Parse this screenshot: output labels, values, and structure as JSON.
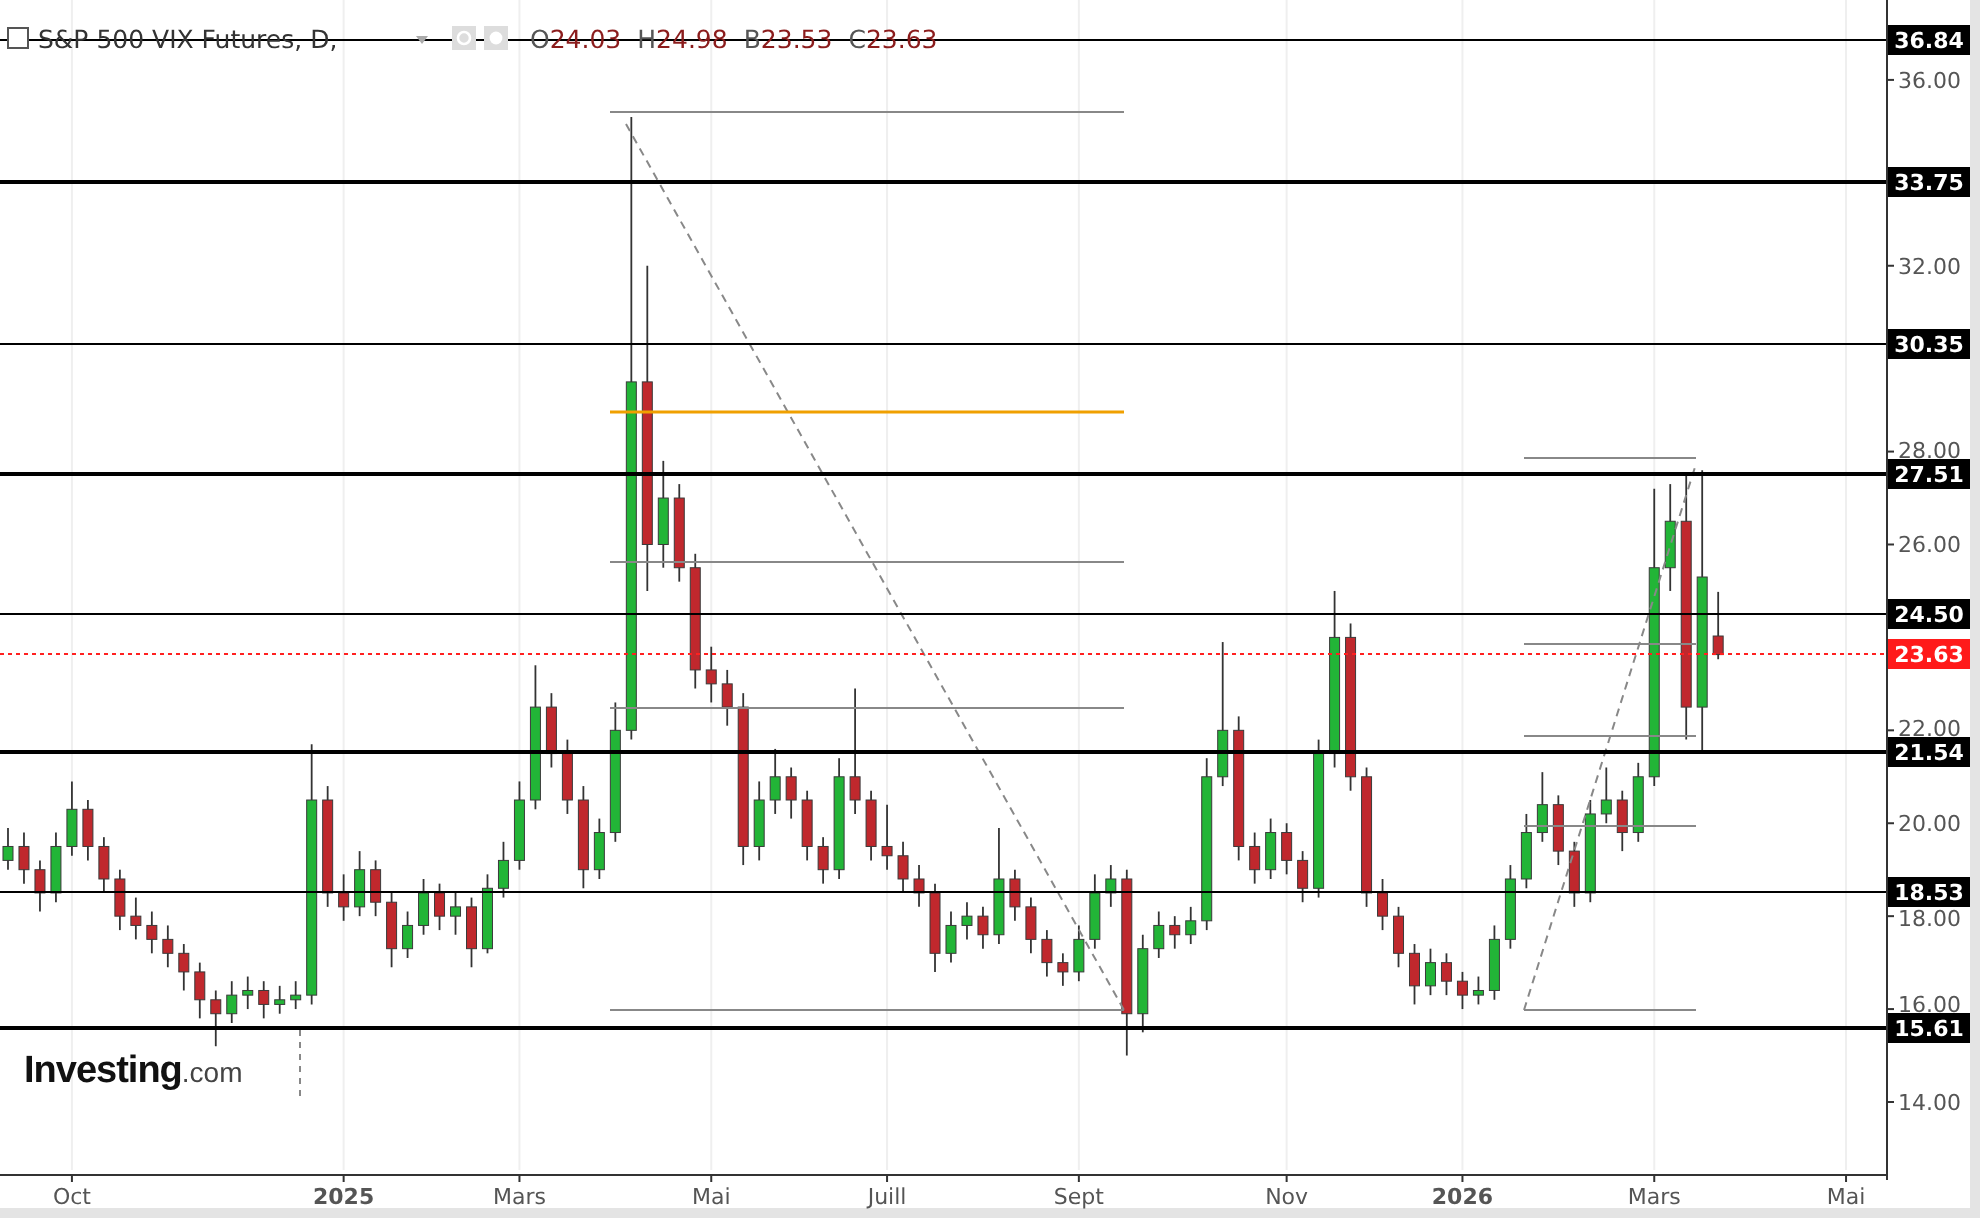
{
  "header": {
    "title": "S&P 500 VIX Futures, D,",
    "quote": [
      {
        "key": "O",
        "value": "24.03"
      },
      {
        "key": "H",
        "value": "24.98"
      },
      {
        "key": "B",
        "value": "23.53"
      },
      {
        "key": "C",
        "value": "23.63"
      }
    ]
  },
  "chart": {
    "chart_data": {
      "type": "candlestick",
      "categories": [
        null,
        null,
        null,
        null,
        "Oct",
        null,
        null,
        null,
        null,
        null,
        null,
        null,
        null,
        null,
        null,
        null,
        null,
        null,
        null,
        null,
        null,
        "2025",
        null,
        null,
        null,
        null,
        null,
        null,
        null,
        null,
        null,
        null,
        "Mars",
        null,
        null,
        null,
        null,
        null,
        null,
        null,
        null,
        null,
        null,
        null,
        "Mai",
        null,
        null,
        null,
        null,
        null,
        null,
        null,
        null,
        null,
        null,
        "Juill",
        null,
        null,
        null,
        null,
        null,
        null,
        null,
        null,
        null,
        null,
        null,
        "Sept",
        null,
        null,
        null,
        null,
        null,
        null,
        null,
        null,
        null,
        null,
        null,
        null,
        "Nov",
        null,
        null,
        null,
        null,
        null,
        null,
        null,
        null,
        null,
        null,
        "2026",
        null,
        null,
        null,
        null,
        null,
        null,
        null,
        null,
        null,
        null,
        null,
        "Mars",
        null,
        null,
        null,
        null,
        null,
        null,
        null,
        null,
        null,
        null,
        null,
        "Mai"
      ],
      "ohlc": [
        [
          19.2,
          19.9,
          19.0,
          19.5
        ],
        [
          19.5,
          19.8,
          18.7,
          19.0
        ],
        [
          19.0,
          19.2,
          18.1,
          18.5
        ],
        [
          18.5,
          19.8,
          18.3,
          19.5
        ],
        [
          19.5,
          20.9,
          19.3,
          20.3
        ],
        [
          20.3,
          20.5,
          19.2,
          19.5
        ],
        [
          19.5,
          19.7,
          18.5,
          18.8
        ],
        [
          18.8,
          19.0,
          17.7,
          18.0
        ],
        [
          18.0,
          18.4,
          17.5,
          17.8
        ],
        [
          17.8,
          18.1,
          17.2,
          17.5
        ],
        [
          17.5,
          17.8,
          16.9,
          17.2
        ],
        [
          17.2,
          17.4,
          16.4,
          16.8
        ],
        [
          16.8,
          17.0,
          15.8,
          16.2
        ],
        [
          16.2,
          16.4,
          15.2,
          15.9
        ],
        [
          15.9,
          16.6,
          15.7,
          16.3
        ],
        [
          16.3,
          16.7,
          16.0,
          16.4
        ],
        [
          16.4,
          16.6,
          15.8,
          16.1
        ],
        [
          16.1,
          16.5,
          15.9,
          16.2
        ],
        [
          16.2,
          16.6,
          16.0,
          16.3
        ],
        [
          16.3,
          21.7,
          16.1,
          20.5
        ],
        [
          20.5,
          20.8,
          18.2,
          18.5
        ],
        [
          18.5,
          18.9,
          17.9,
          18.2
        ],
        [
          18.2,
          19.4,
          18.0,
          19.0
        ],
        [
          19.0,
          19.2,
          18.0,
          18.3
        ],
        [
          18.3,
          18.5,
          16.9,
          17.3
        ],
        [
          17.3,
          18.1,
          17.1,
          17.8
        ],
        [
          17.8,
          18.8,
          17.6,
          18.5
        ],
        [
          18.5,
          18.7,
          17.7,
          18.0
        ],
        [
          18.0,
          18.5,
          17.6,
          18.2
        ],
        [
          18.2,
          18.4,
          16.9,
          17.3
        ],
        [
          17.3,
          18.9,
          17.2,
          18.6
        ],
        [
          18.6,
          19.6,
          18.4,
          19.2
        ],
        [
          19.2,
          20.9,
          19.0,
          20.5
        ],
        [
          20.5,
          23.4,
          20.3,
          22.5
        ],
        [
          22.5,
          22.8,
          21.2,
          21.5
        ],
        [
          21.5,
          21.8,
          20.2,
          20.5
        ],
        [
          20.5,
          20.8,
          18.6,
          19.0
        ],
        [
          19.0,
          20.1,
          18.8,
          19.8
        ],
        [
          19.8,
          22.6,
          19.6,
          22.0
        ],
        [
          22.0,
          35.2,
          21.8,
          29.5
        ],
        [
          29.5,
          32.0,
          25.0,
          26.0
        ],
        [
          26.0,
          27.8,
          25.5,
          27.0
        ],
        [
          27.0,
          27.3,
          25.2,
          25.5
        ],
        [
          25.5,
          25.8,
          22.9,
          23.3
        ],
        [
          23.3,
          23.8,
          22.6,
          23.0
        ],
        [
          23.0,
          23.3,
          22.1,
          22.5
        ],
        [
          22.5,
          22.8,
          19.1,
          19.5
        ],
        [
          19.5,
          20.9,
          19.2,
          20.5
        ],
        [
          20.5,
          21.6,
          20.2,
          21.0
        ],
        [
          21.0,
          21.2,
          20.1,
          20.5
        ],
        [
          20.5,
          20.7,
          19.2,
          19.5
        ],
        [
          19.5,
          19.7,
          18.7,
          19.0
        ],
        [
          19.0,
          21.4,
          18.8,
          21.0
        ],
        [
          21.0,
          22.9,
          20.2,
          20.5
        ],
        [
          20.5,
          20.7,
          19.2,
          19.5
        ],
        [
          19.5,
          20.4,
          19.0,
          19.3
        ],
        [
          19.3,
          19.6,
          18.5,
          18.8
        ],
        [
          18.8,
          19.1,
          18.2,
          18.5
        ],
        [
          18.5,
          18.7,
          16.8,
          17.2
        ],
        [
          17.2,
          18.1,
          17.0,
          17.8
        ],
        [
          17.8,
          18.3,
          17.5,
          18.0
        ],
        [
          18.0,
          18.2,
          17.3,
          17.6
        ],
        [
          17.6,
          19.9,
          17.4,
          18.8
        ],
        [
          18.8,
          19.0,
          17.9,
          18.2
        ],
        [
          18.2,
          18.4,
          17.2,
          17.5
        ],
        [
          17.5,
          17.7,
          16.7,
          17.0
        ],
        [
          17.0,
          17.2,
          16.5,
          16.8
        ],
        [
          16.8,
          17.8,
          16.6,
          17.5
        ],
        [
          17.5,
          18.9,
          17.3,
          18.5
        ],
        [
          18.5,
          19.1,
          18.2,
          18.8
        ],
        [
          18.8,
          19.0,
          15.0,
          15.9
        ],
        [
          15.9,
          17.6,
          15.5,
          17.3
        ],
        [
          17.3,
          18.1,
          17.1,
          17.8
        ],
        [
          17.8,
          18.0,
          17.3,
          17.6
        ],
        [
          17.6,
          18.2,
          17.4,
          17.9
        ],
        [
          17.9,
          21.4,
          17.7,
          21.0
        ],
        [
          21.0,
          23.9,
          20.8,
          22.0
        ],
        [
          22.0,
          22.3,
          19.2,
          19.5
        ],
        [
          19.5,
          19.8,
          18.7,
          19.0
        ],
        [
          19.0,
          20.1,
          18.8,
          19.8
        ],
        [
          19.8,
          20.0,
          18.9,
          19.2
        ],
        [
          19.2,
          19.4,
          18.3,
          18.6
        ],
        [
          18.6,
          21.8,
          18.4,
          21.5
        ],
        [
          21.5,
          25.0,
          21.2,
          24.0
        ],
        [
          24.0,
          24.3,
          20.7,
          21.0
        ],
        [
          21.0,
          21.2,
          18.2,
          18.5
        ],
        [
          18.5,
          18.8,
          17.7,
          18.0
        ],
        [
          18.0,
          18.2,
          16.9,
          17.2
        ],
        [
          17.2,
          17.4,
          16.1,
          16.5
        ],
        [
          16.5,
          17.3,
          16.3,
          17.0
        ],
        [
          17.0,
          17.2,
          16.3,
          16.6
        ],
        [
          16.6,
          16.8,
          16.0,
          16.3
        ],
        [
          16.3,
          16.7,
          16.1,
          16.4
        ],
        [
          16.4,
          17.8,
          16.2,
          17.5
        ],
        [
          17.5,
          19.1,
          17.3,
          18.8
        ],
        [
          18.8,
          20.2,
          18.6,
          19.8
        ],
        [
          19.8,
          21.1,
          19.6,
          20.4
        ],
        [
          20.4,
          20.6,
          19.1,
          19.4
        ],
        [
          19.4,
          19.6,
          18.2,
          18.5
        ],
        [
          18.5,
          20.5,
          18.3,
          20.2
        ],
        [
          20.2,
          21.2,
          20.0,
          20.5
        ],
        [
          20.5,
          20.7,
          19.4,
          19.8
        ],
        [
          19.8,
          21.3,
          19.6,
          21.0
        ],
        [
          21.0,
          27.2,
          20.8,
          25.5
        ],
        [
          25.5,
          27.3,
          25.0,
          26.5
        ],
        [
          26.5,
          27.5,
          21.8,
          22.5
        ],
        [
          22.5,
          27.6,
          21.5,
          25.3
        ],
        [
          24.03,
          24.98,
          23.53,
          23.63
        ],
        null,
        null,
        null,
        null,
        null,
        null,
        null,
        null
      ],
      "grid": true,
      "ylim": [
        12.45,
        37.72
      ],
      "yticks": [
        {
          "value": 36,
          "label": "36.00"
        },
        {
          "value": 32,
          "label": "32.00"
        },
        {
          "value": 28,
          "label": "28.00"
        },
        {
          "value": 26,
          "label": "26.00"
        },
        {
          "value": 22,
          "label": "22.00"
        },
        {
          "value": 20,
          "label": "20.00"
        },
        {
          "value": 18,
          "label": "18.00"
        },
        {
          "value": 16,
          "label": "16.00"
        },
        {
          "value": 14,
          "label": "14.00"
        }
      ]
    },
    "tick_styles": [
      {
        "bold": false
      },
      {
        "bold": true
      },
      {
        "bold": false
      },
      {
        "bold": false
      },
      {
        "bold": false
      },
      {
        "bold": false
      },
      {
        "bold": false
      },
      {
        "bold": true
      },
      {
        "bold": false
      },
      {
        "bold": false
      }
    ]
  },
  "price_levels": [
    {
      "label": "36.84",
      "kind": "minor"
    },
    {
      "label": "33.75",
      "kind": "major"
    },
    {
      "label": "30.35",
      "kind": "minor"
    },
    {
      "label": "27.51",
      "kind": "major"
    },
    {
      "label": "24.50",
      "kind": "minor"
    },
    {
      "label": "23.63",
      "kind": "current"
    },
    {
      "label": "21.54",
      "kind": "major"
    },
    {
      "label": "18.53",
      "kind": "minor"
    },
    {
      "label": "15.61",
      "kind": "major"
    }
  ],
  "logo": {
    "brand": "Investing",
    "suffix": ".com"
  }
}
